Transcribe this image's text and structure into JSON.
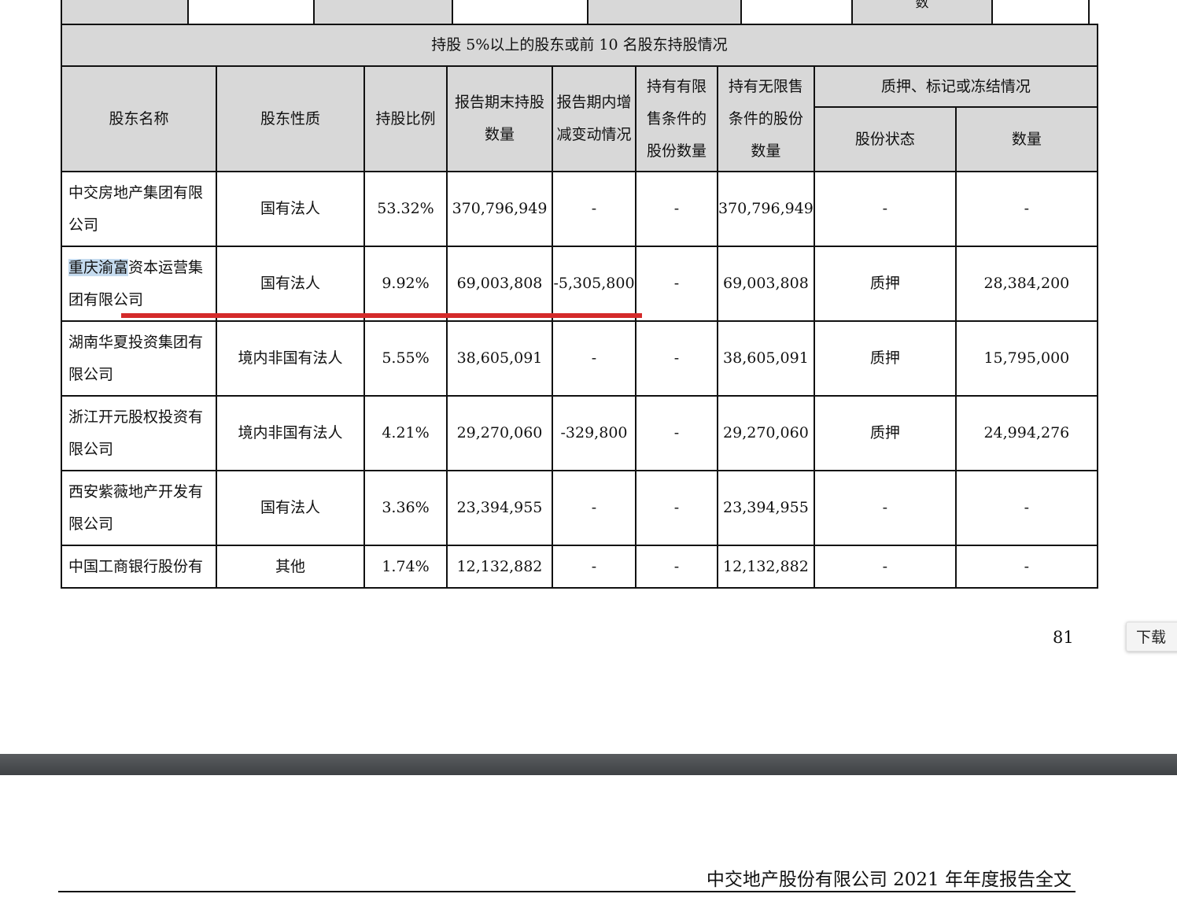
{
  "previous_table_fragment": {
    "partial_text": "数"
  },
  "shareholder_table": {
    "title": "持股 5%以上的股东或前 10 名股东持股情况",
    "headers": {
      "name": "股东名称",
      "nature": "股东性质",
      "ratio": "持股比例",
      "end_shares": "报告期末持股数量",
      "change": "报告期内增减变动情况",
      "restricted": "持有有限售条件的股份数量",
      "unrestricted": "持有无限售条件的股份数量",
      "pledge_group": "质押、标记或冻结情况",
      "pledge_status": "股份状态",
      "pledge_qty": "数量"
    },
    "rows": [
      {
        "name": "中交房地产集团有限公司",
        "nature": "国有法人",
        "ratio": "53.32%",
        "end_shares": "370,796,949",
        "change": "-",
        "restricted": "-",
        "unrestricted": "370,796,949",
        "pledge_status": "-",
        "pledge_qty": "-"
      },
      {
        "name_highlight": "重庆渝富",
        "name_rest": "资本运营集团有限公司",
        "nature": "国有法人",
        "ratio": "9.92%",
        "end_shares": "69,003,808",
        "change": "-5,305,800",
        "restricted": "-",
        "unrestricted": "69,003,808",
        "pledge_status": "质押",
        "pledge_qty": "28,384,200"
      },
      {
        "name": "湖南华夏投资集团有限公司",
        "nature": "境内非国有法人",
        "ratio": "5.55%",
        "end_shares": "38,605,091",
        "change": "-",
        "restricted": "-",
        "unrestricted": "38,605,091",
        "pledge_status": "质押",
        "pledge_qty": "15,795,000"
      },
      {
        "name": "浙江开元股权投资有限公司",
        "nature": "境内非国有法人",
        "ratio": "4.21%",
        "end_shares": "29,270,060",
        "change": "-329,800",
        "restricted": "-",
        "unrestricted": "29,270,060",
        "pledge_status": "质押",
        "pledge_qty": "24,994,276"
      },
      {
        "name": "西安紫薇地产开发有限公司",
        "nature": "国有法人",
        "ratio": "3.36%",
        "end_shares": "23,394,955",
        "change": "-",
        "restricted": "-",
        "unrestricted": "23,394,955",
        "pledge_status": "-",
        "pledge_qty": "-"
      },
      {
        "name": "中国工商银行股份有",
        "nature": "其他",
        "ratio": "1.74%",
        "end_shares": "12,132,882",
        "change": "-",
        "restricted": "-",
        "unrestricted": "12,132,882",
        "pledge_status": "-",
        "pledge_qty": "-"
      }
    ]
  },
  "page_number": "81",
  "download_button": {
    "label": "下载"
  },
  "footer": {
    "title": "中交地产股份有限公司 2021 年年度报告全文"
  },
  "colors": {
    "header_bg": "#d8d8d8",
    "highlight": "#c5dbef",
    "annotation_line": "#d42a2a",
    "gap_bar": "#4a4d50"
  }
}
